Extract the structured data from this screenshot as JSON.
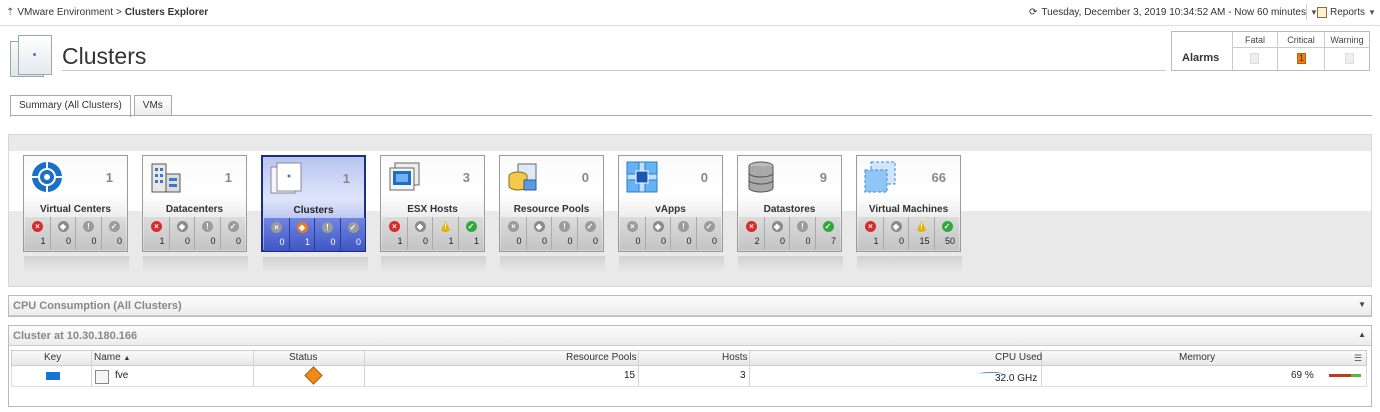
{
  "breadcrumb": {
    "parent": "VMware Environment",
    "separator": ">",
    "current": "Clusters Explorer"
  },
  "time_range": "Tuesday, December 3, 2019 10:34:52 AM - Now 60 minutes",
  "reports_label": "Reports",
  "page_title": "Clusters",
  "alarms": {
    "label": "Alarms",
    "headers": [
      "Fatal",
      "Critical",
      "Warning"
    ],
    "values": [
      "",
      "1",
      ""
    ]
  },
  "tabs": [
    {
      "label": "Summary (All Clusters)",
      "active": true
    },
    {
      "label": "VMs",
      "active": false
    }
  ],
  "tiles": [
    {
      "name": "Virtual Centers",
      "count": "1",
      "icon": "virtual-center-icon",
      "stats": [
        "1",
        "0",
        "0",
        "0"
      ],
      "selected": false
    },
    {
      "name": "Datacenters",
      "count": "1",
      "icon": "datacenter-icon",
      "stats": [
        "1",
        "0",
        "0",
        "0"
      ],
      "selected": false
    },
    {
      "name": "Clusters",
      "count": "1",
      "icon": "cluster-icon",
      "stats": [
        "0",
        "1",
        "0",
        "0"
      ],
      "selected": true
    },
    {
      "name": "ESX Hosts",
      "count": "3",
      "icon": "esx-host-icon",
      "stats": [
        "1",
        "0",
        "1",
        "1"
      ],
      "selected": false
    },
    {
      "name": "Resource Pools",
      "count": "0",
      "icon": "resource-pool-icon",
      "stats": [
        "0",
        "0",
        "0",
        "0"
      ],
      "selected": false
    },
    {
      "name": "vApps",
      "count": "0",
      "icon": "vapp-icon",
      "stats": [
        "0",
        "0",
        "0",
        "0"
      ],
      "selected": false
    },
    {
      "name": "Datastores",
      "count": "9",
      "icon": "datastore-icon",
      "stats": [
        "2",
        "0",
        "0",
        "7"
      ],
      "selected": false
    },
    {
      "name": "Virtual Machines",
      "count": "66",
      "icon": "virtual-machine-icon",
      "stats": [
        "1",
        "0",
        "15",
        "50"
      ],
      "selected": false
    }
  ],
  "status_colors": {
    "fatal": "#d62d2d",
    "critical": "#f07a1a",
    "warning": "#e0b400",
    "normal": "#2faa3a"
  },
  "cpu_panel": {
    "title": "CPU Consumption (All Clusters)"
  },
  "cluster_panel": {
    "title": "Cluster at 10.30.180.166"
  },
  "table": {
    "columns": [
      "Key",
      "Name",
      "Status",
      "Resource Pools",
      "Hosts",
      "CPU Used",
      "Memory"
    ],
    "sort_indicator": "▲",
    "rows": [
      {
        "key_color": "#1473d4",
        "name": "fve",
        "status": "critical",
        "resource_pools": "15",
        "hosts": "3",
        "cpu_used": "32.0 GHz",
        "memory": "69 %"
      }
    ]
  }
}
